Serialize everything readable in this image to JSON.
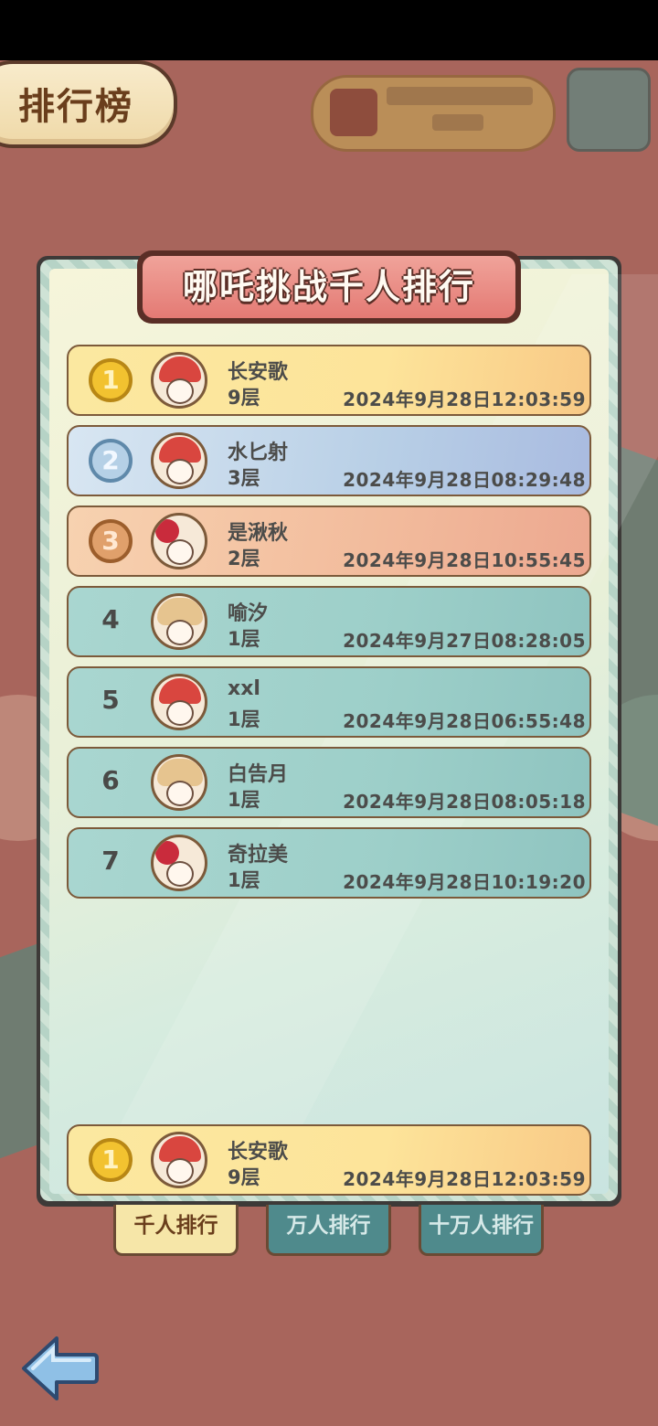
{
  "header": {
    "title": "排行榜"
  },
  "panel": {
    "title": "哪吒挑战千人排行"
  },
  "rankings": [
    {
      "rank": "1",
      "name": "长安歌",
      "level": "9层",
      "time": "2024年9月28日12:03:59"
    },
    {
      "rank": "2",
      "name": "水匕射",
      "level": "3层",
      "time": "2024年9月28日08:29:48"
    },
    {
      "rank": "3",
      "name": "是湫秋",
      "level": "2层",
      "time": "2024年9月28日10:55:45"
    },
    {
      "rank": "4",
      "name": "喻汐",
      "level": "1层",
      "time": "2024年9月27日08:28:05"
    },
    {
      "rank": "5",
      "name": "xxl",
      "level": "1层",
      "time": "2024年9月28日06:55:48"
    },
    {
      "rank": "6",
      "name": "白告月",
      "level": "1层",
      "time": "2024年9月28日08:05:18"
    },
    {
      "rank": "7",
      "name": "奇拉美",
      "level": "1层",
      "time": "2024年9月28日10:19:20"
    }
  ],
  "my_rank": {
    "rank": "1",
    "name": "长安歌",
    "level": "9层",
    "time": "2024年9月28日12:03:59"
  },
  "tabs": [
    {
      "label": "千人排行",
      "active": true
    },
    {
      "label": "万人排行",
      "active": false
    },
    {
      "label": "十万人排行",
      "active": false
    }
  ],
  "icons": {
    "back": "back-arrow-icon"
  },
  "colors": {
    "background": "#a8655c",
    "gold_row": "#fde49a",
    "silver_row": "#b8cfe6",
    "bronze_row": "#f2bb9c",
    "teal_row": "#9dcfc9",
    "active_tab": "#f6e6a8",
    "inactive_tab": "#4f8a8c"
  }
}
